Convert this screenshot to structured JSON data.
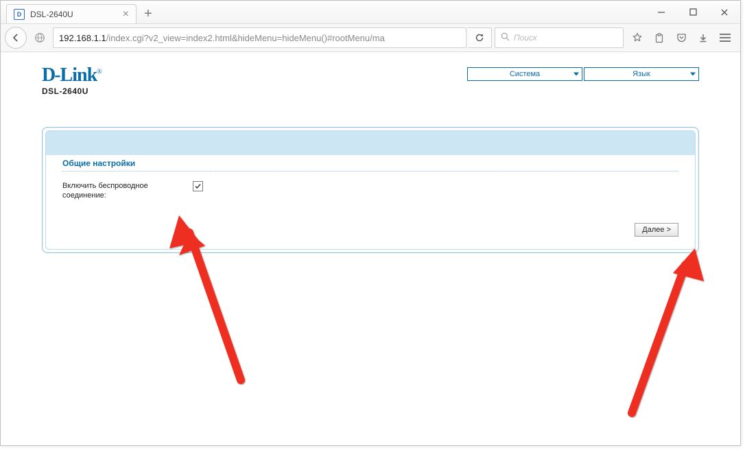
{
  "window": {
    "tab_title": "DSL-2640U",
    "favicon_letter": "D"
  },
  "toolbar": {
    "url_host": "192.168.1.1",
    "url_rest": "/index.cgi?v2_view=index2.html&hideMenu=hideMenu()#rootMenu/ma",
    "search_placeholder": "Поиск"
  },
  "header": {
    "brand": "D-Link",
    "model": "DSL-2640U",
    "system_dropdown": "Система",
    "language_dropdown": "Язык"
  },
  "panel": {
    "section_title": "Общие настройки",
    "wireless_label": "Включить беспроводное соединение:",
    "wireless_checked": true,
    "next_button": "Далее >"
  }
}
